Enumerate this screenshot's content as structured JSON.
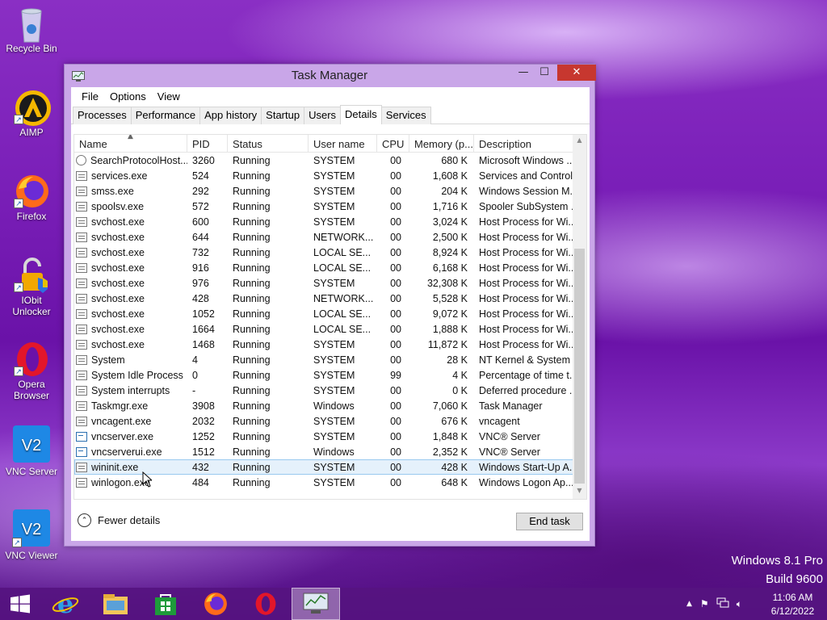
{
  "desktop": {
    "icons": [
      {
        "label": "Recycle Bin",
        "icon": "recycle-bin-icon"
      },
      {
        "label": "AIMP",
        "icon": "aimp-icon"
      },
      {
        "label": "Firefox",
        "icon": "firefox-icon"
      },
      {
        "label": "IObit Unlocker",
        "icon": "iobit-unlocker-icon"
      },
      {
        "label": "Opera Browser",
        "icon": "opera-icon"
      },
      {
        "label": "VNC Server",
        "icon": "vnc-server-icon"
      },
      {
        "label": "VNC Viewer",
        "icon": "vnc-viewer-icon"
      }
    ],
    "watermark": {
      "line1": "Windows 8.1 Pro",
      "line2": "Build 9600"
    }
  },
  "window": {
    "title": "Task Manager",
    "controls": {
      "minimize": "—",
      "maximize": "☐",
      "close": "✕"
    },
    "menu": [
      "File",
      "Options",
      "View"
    ],
    "tabs": [
      "Processes",
      "Performance",
      "App history",
      "Startup",
      "Users",
      "Details",
      "Services"
    ],
    "active_tab": "Details",
    "columns": [
      "Name",
      "PID",
      "Status",
      "User name",
      "CPU",
      "Memory (p...",
      "Description"
    ],
    "rows": [
      {
        "name": "SearchProtocolHost....",
        "pid": "3260",
        "status": "Running",
        "user": "SYSTEM",
        "cpu": "00",
        "mem": "680 K",
        "desc": "Microsoft Windows ...",
        "icon": "search"
      },
      {
        "name": "services.exe",
        "pid": "524",
        "status": "Running",
        "user": "SYSTEM",
        "cpu": "00",
        "mem": "1,608 K",
        "desc": "Services and Control...",
        "icon": "proc"
      },
      {
        "name": "smss.exe",
        "pid": "292",
        "status": "Running",
        "user": "SYSTEM",
        "cpu": "00",
        "mem": "204 K",
        "desc": "Windows Session M...",
        "icon": "proc"
      },
      {
        "name": "spoolsv.exe",
        "pid": "572",
        "status": "Running",
        "user": "SYSTEM",
        "cpu": "00",
        "mem": "1,716 K",
        "desc": "Spooler SubSystem ...",
        "icon": "printer"
      },
      {
        "name": "svchost.exe",
        "pid": "600",
        "status": "Running",
        "user": "SYSTEM",
        "cpu": "00",
        "mem": "3,024 K",
        "desc": "Host Process for Wi...",
        "icon": "proc"
      },
      {
        "name": "svchost.exe",
        "pid": "644",
        "status": "Running",
        "user": "NETWORK...",
        "cpu": "00",
        "mem": "2,500 K",
        "desc": "Host Process for Wi...",
        "icon": "proc"
      },
      {
        "name": "svchost.exe",
        "pid": "732",
        "status": "Running",
        "user": "LOCAL SE...",
        "cpu": "00",
        "mem": "8,924 K",
        "desc": "Host Process for Wi...",
        "icon": "proc"
      },
      {
        "name": "svchost.exe",
        "pid": "916",
        "status": "Running",
        "user": "LOCAL SE...",
        "cpu": "00",
        "mem": "6,168 K",
        "desc": "Host Process for Wi...",
        "icon": "proc"
      },
      {
        "name": "svchost.exe",
        "pid": "976",
        "status": "Running",
        "user": "SYSTEM",
        "cpu": "00",
        "mem": "32,308 K",
        "desc": "Host Process for Wi...",
        "icon": "proc"
      },
      {
        "name": "svchost.exe",
        "pid": "428",
        "status": "Running",
        "user": "NETWORK...",
        "cpu": "00",
        "mem": "5,528 K",
        "desc": "Host Process for Wi...",
        "icon": "proc"
      },
      {
        "name": "svchost.exe",
        "pid": "1052",
        "status": "Running",
        "user": "LOCAL SE...",
        "cpu": "00",
        "mem": "9,072 K",
        "desc": "Host Process for Wi...",
        "icon": "proc"
      },
      {
        "name": "svchost.exe",
        "pid": "1664",
        "status": "Running",
        "user": "LOCAL SE...",
        "cpu": "00",
        "mem": "1,888 K",
        "desc": "Host Process for Wi...",
        "icon": "proc"
      },
      {
        "name": "svchost.exe",
        "pid": "1468",
        "status": "Running",
        "user": "SYSTEM",
        "cpu": "00",
        "mem": "11,872 K",
        "desc": "Host Process for Wi...",
        "icon": "proc"
      },
      {
        "name": "System",
        "pid": "4",
        "status": "Running",
        "user": "SYSTEM",
        "cpu": "00",
        "mem": "28 K",
        "desc": "NT Kernel & System",
        "icon": "proc"
      },
      {
        "name": "System Idle Process",
        "pid": "0",
        "status": "Running",
        "user": "SYSTEM",
        "cpu": "99",
        "mem": "4 K",
        "desc": "Percentage of time t...",
        "icon": "proc"
      },
      {
        "name": "System interrupts",
        "pid": "-",
        "status": "Running",
        "user": "SYSTEM",
        "cpu": "00",
        "mem": "0 K",
        "desc": "Deferred procedure ...",
        "icon": "proc"
      },
      {
        "name": "Taskmgr.exe",
        "pid": "3908",
        "status": "Running",
        "user": "Windows",
        "cpu": "00",
        "mem": "7,060 K",
        "desc": "Task Manager",
        "icon": "taskmgr"
      },
      {
        "name": "vncagent.exe",
        "pid": "2032",
        "status": "Running",
        "user": "SYSTEM",
        "cpu": "00",
        "mem": "676 K",
        "desc": "vncagent",
        "icon": "proc"
      },
      {
        "name": "vncserver.exe",
        "pid": "1252",
        "status": "Running",
        "user": "SYSTEM",
        "cpu": "00",
        "mem": "1,848 K",
        "desc": "VNC® Server",
        "icon": "vnc"
      },
      {
        "name": "vncserverui.exe",
        "pid": "1512",
        "status": "Running",
        "user": "Windows",
        "cpu": "00",
        "mem": "2,352 K",
        "desc": "VNC® Server",
        "icon": "vnc"
      },
      {
        "name": "wininit.exe",
        "pid": "432",
        "status": "Running",
        "user": "SYSTEM",
        "cpu": "00",
        "mem": "428 K",
        "desc": "Windows Start-Up A...",
        "icon": "proc",
        "selected": true
      },
      {
        "name": "winlogon.exe",
        "pid": "484",
        "status": "Running",
        "user": "SYSTEM",
        "cpu": "00",
        "mem": "648 K",
        "desc": "Windows Logon Ap...",
        "icon": "proc"
      }
    ],
    "footer": {
      "fewer_details": "Fewer details",
      "end_task": "End task"
    }
  },
  "taskbar": {
    "items": [
      "start-icon",
      "internet-explorer-icon",
      "file-explorer-icon",
      "store-icon",
      "firefox-icon",
      "opera-icon",
      "task-manager-icon"
    ],
    "active_item": "task-manager-icon",
    "tray_icons": [
      "show-hidden-icons-icon",
      "flag-icon",
      "network-icon",
      "volume-icon"
    ],
    "time": "11:06 AM",
    "date": "6/12/2022"
  }
}
